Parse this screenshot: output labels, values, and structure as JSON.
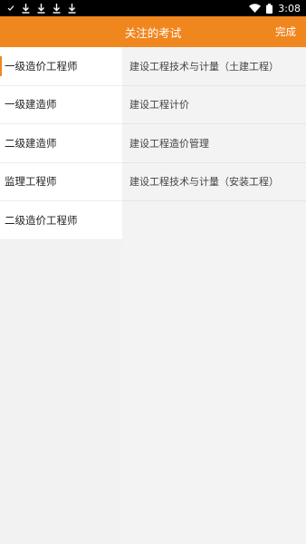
{
  "status_bar": {
    "time": "3:08",
    "left_icons": [
      "check-icon",
      "download-icon",
      "download-icon",
      "download-icon",
      "download-icon"
    ],
    "right_icons": [
      "wifi-icon",
      "battery-icon"
    ]
  },
  "header": {
    "title": "关注的考试",
    "done_label": "完成",
    "background": "#f0861e"
  },
  "categories": [
    {
      "label": "一级造价工程师",
      "active": true
    },
    {
      "label": "一级建造师",
      "active": false
    },
    {
      "label": "二级建造师",
      "active": false
    },
    {
      "label": "监理工程师",
      "active": false
    },
    {
      "label": "二级造价工程师",
      "active": false
    }
  ],
  "subjects": [
    {
      "label": "建设工程技术与计量（土建工程）"
    },
    {
      "label": "建设工程计价"
    },
    {
      "label": "建设工程造价管理"
    },
    {
      "label": "建设工程技术与计量（安装工程）"
    }
  ]
}
